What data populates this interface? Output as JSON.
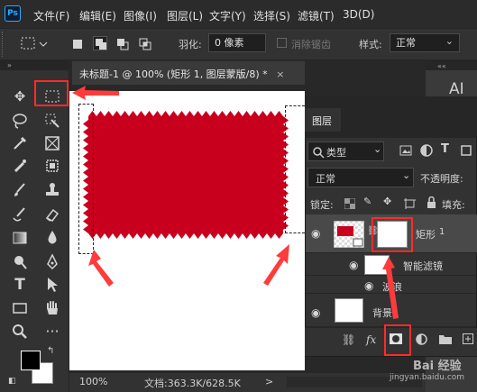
{
  "app": {
    "logo": "Ps"
  },
  "menu": [
    "文件(F)",
    "编辑(E)",
    "图像(I)",
    "图层(L)",
    "文字(Y)",
    "选择(S)",
    "滤镜(T)",
    "3D(D)"
  ],
  "options": {
    "feather_label": "羽化:",
    "feather_value": "0 像素",
    "antialias_label": "消除锯齿",
    "style_label": "样式:",
    "style_value": "正常"
  },
  "document": {
    "tab_title": "未标题-1 @ 100% (矩形 1, 图层蒙版/8) *",
    "close_glyph": "×",
    "zoom": "100%",
    "doc_info": "文档:363.3K/628.5K",
    "expand_glyph": ">",
    "shape_color": "#c8001e"
  },
  "layers_panel": {
    "title": "图层",
    "filter_kind": "类型",
    "blend_mode": "正常",
    "opacity_label": "不透明度:",
    "lock_label": "锁定:",
    "fill_label": "填充:",
    "layers": [
      {
        "name": "矩形",
        "badge": "1"
      },
      {
        "name": "智能滤镜"
      },
      {
        "name": "波浪"
      },
      {
        "name": "背景"
      }
    ],
    "footer_fx": "fx"
  },
  "right_strip": {
    "label": "AI"
  },
  "watermark": {
    "brand": "Bai 经验",
    "url": "jingyan.baidu.com"
  },
  "colors": {
    "highlight": "#ff2a2a",
    "accent": "#31a8ff"
  }
}
